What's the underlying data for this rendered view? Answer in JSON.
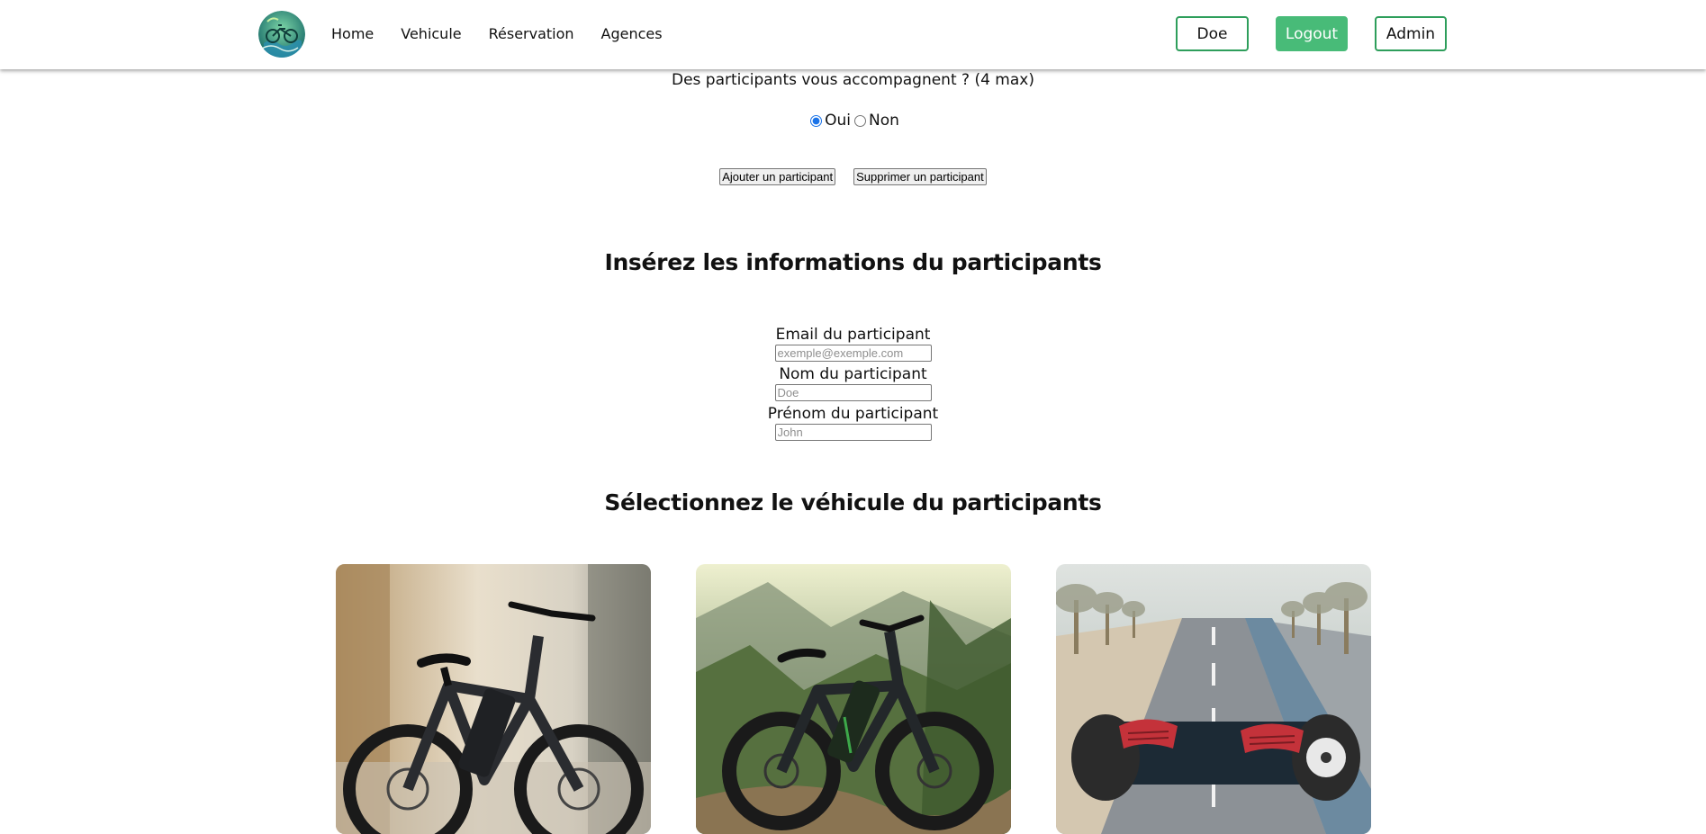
{
  "header": {
    "logo_icon": "ebike-logo-icon",
    "nav": [
      "Home",
      "Vehicule",
      "Réservation",
      "Agences"
    ],
    "user_button": "Doe",
    "logout_button": "Logout",
    "admin_button": "Admin",
    "accent_color": "#48bb78"
  },
  "participants": {
    "question": "Des participants vous accompagnent ? (4 max)",
    "options": [
      {
        "label": "Oui",
        "checked": true
      },
      {
        "label": "Non",
        "checked": false
      }
    ],
    "add_button": "Ajouter un participant",
    "remove_button": "Supprimer un participant"
  },
  "info_section": {
    "title": "Insérez les informations du participants",
    "fields": [
      {
        "label": "Email du participant",
        "placeholder": "exemple@exemple.com",
        "value": ""
      },
      {
        "label": "Nom du participant",
        "placeholder": "Doe",
        "value": ""
      },
      {
        "label": "Prénom du participant",
        "placeholder": "John",
        "value": ""
      }
    ]
  },
  "vehicle_section": {
    "title": "Sélectionnez le véhicule du participants",
    "vehicles": [
      {
        "image": "city-ebike-photo"
      },
      {
        "image": "mountain-ebike-photo"
      },
      {
        "image": "hoverboard-photo"
      }
    ]
  }
}
